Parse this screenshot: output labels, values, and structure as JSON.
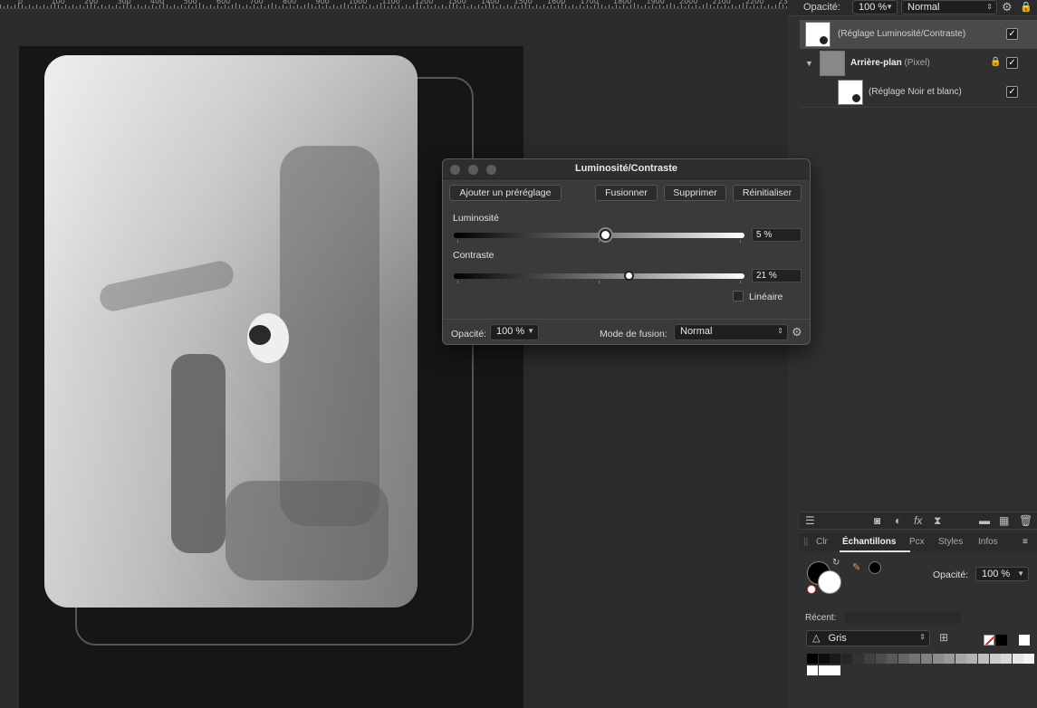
{
  "ruler": {
    "labels": [
      "0",
      "100",
      "200",
      "300",
      "400",
      "500",
      "600",
      "700",
      "800",
      "900",
      "1000",
      "1100",
      "1200",
      "1300",
      "1400",
      "1500",
      "1600",
      "1700",
      "1800",
      "1900",
      "2000",
      "2100",
      "2200",
      "2300"
    ]
  },
  "top_bar": {
    "opacity_label": "Opacité:",
    "opacity_value": "100 %",
    "blend_mode": "Normal"
  },
  "layers": [
    {
      "label": "(Réglage Luminosité/Contraste)",
      "checked": "✓"
    },
    {
      "name": "Arrière-plan",
      "kind": "(Pixel)",
      "checked": "✓"
    },
    {
      "label": "(Réglage Noir et blanc)",
      "checked": "✓"
    }
  ],
  "icons_bar": [
    "layers-icon",
    "mask-icon",
    "adjustment-icon",
    "fx-icon",
    "hourglass-icon",
    "folder-icon",
    "checker-icon",
    "trash-icon"
  ],
  "tabs": [
    {
      "label": "Clr",
      "active": false
    },
    {
      "label": "Échantillons",
      "active": true
    },
    {
      "label": "Pcx",
      "active": false
    },
    {
      "label": "Styles",
      "active": false
    },
    {
      "label": "Infos",
      "active": false
    }
  ],
  "swatches": {
    "opacity_label": "Opacité:",
    "opacity_value": "100 %",
    "recent_label": "Récent:",
    "palette_name": "Gris",
    "grays": [
      "#000000",
      "#0d0d0d",
      "#1a1a1a",
      "#262626",
      "#333333",
      "#404040",
      "#4d4d4d",
      "#595959",
      "#666666",
      "#737373",
      "#808080",
      "#8c8c8c",
      "#999999",
      "#a6a6a6",
      "#b3b3b3",
      "#bfbfbf",
      "#cccccc",
      "#d9d9d9",
      "#e6e6e6",
      "#f2f2f2",
      "#ffffff",
      "#ffffff",
      "#ffffff"
    ]
  },
  "dialog": {
    "title": "Luminosité/Contraste",
    "buttons": {
      "add_preset": "Ajouter un préréglage",
      "merge": "Fusionner",
      "delete": "Supprimer",
      "reset": "Réinitialiser"
    },
    "brightness": {
      "label": "Luminosité",
      "value": "5 %",
      "fraction": 0.52
    },
    "contrast": {
      "label": "Contraste",
      "value": "21 %",
      "fraction": 0.6
    },
    "linear_label": "Linéaire",
    "opacity_label": "Opacité:",
    "opacity_value": "100 %",
    "blend_label": "Mode de fusion:",
    "blend_value": "Normal"
  }
}
